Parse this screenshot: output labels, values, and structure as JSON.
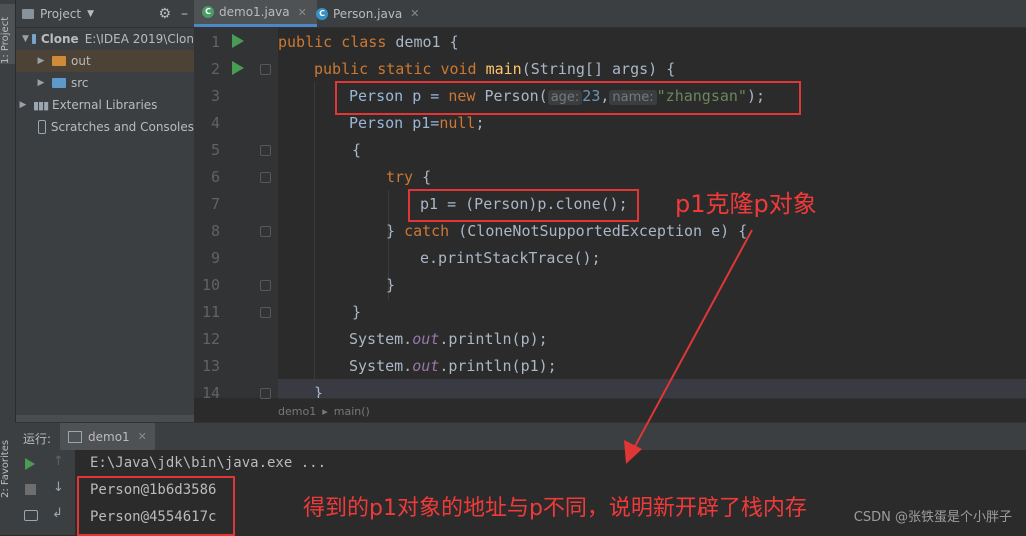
{
  "left_strip": {
    "project_tab": "1: Project",
    "favorites_tab": "2: Favorites"
  },
  "project": {
    "header_label": "Project",
    "tree": [
      {
        "label": "Clone",
        "extra": "E:\\IDEA 2019\\Clon",
        "icon": "module-folder-icon",
        "expanded": true
      },
      {
        "label": "out",
        "icon": "folder-orange-icon",
        "expanded": false
      },
      {
        "label": "src",
        "icon": "folder-blue-icon",
        "expanded": false
      },
      {
        "label": "External Libraries",
        "icon": "library-icon",
        "expanded": false
      },
      {
        "label": "Scratches and Consoles",
        "icon": "scratch-icon",
        "expanded": false
      }
    ]
  },
  "editor": {
    "tabs": [
      {
        "label": "demo1.java",
        "active": true
      },
      {
        "label": "Person.java",
        "active": false
      }
    ],
    "line_numbers": [
      "1",
      "2",
      "3",
      "4",
      "5",
      "6",
      "7",
      "8",
      "9",
      "10",
      "11",
      "12",
      "13",
      "14"
    ],
    "breadcrumb": {
      "first": "demo1",
      "second": "main()"
    },
    "hints": {
      "age": "age:",
      "name": "name:"
    },
    "code": {
      "l1": [
        "public",
        "class",
        "demo1 {"
      ],
      "l2": [
        "public",
        "static",
        "void",
        "main",
        "(String[] args) {"
      ],
      "l3": [
        "Person p = ",
        "new",
        " Person(",
        "23",
        ",",
        "\"zhangsan\"",
        ");"
      ],
      "l4": [
        "Person p1=",
        "null",
        ";"
      ],
      "l5": "{",
      "l6": [
        "try",
        " {"
      ],
      "l7": [
        "p1 = (Person)p.clone();"
      ],
      "l8": [
        "} ",
        "catch",
        " (CloneNotSupportedException e) {"
      ],
      "l9": "e.printStackTrace();",
      "l10": "}",
      "l11": "}",
      "l12": [
        "System.",
        "out",
        ".println(p);"
      ],
      "l13": [
        "System.",
        "out",
        ".println(p1);"
      ],
      "l14": "}"
    }
  },
  "run": {
    "label": "运行:",
    "tab": "demo1",
    "console_lines": [
      "E:\\Java\\jdk\\bin\\java.exe ...",
      "Person@1b6d3586",
      "Person@4554617c"
    ]
  },
  "annotations": {
    "clone_note": "p1克隆p对象",
    "result_note": "得到的p1对象的地址与p不同，说明新开辟了栈内存"
  },
  "watermark": "CSDN @张铁蛋是个小胖子",
  "colors": {
    "annotation_red": "#e03636",
    "keyword": "#cc7832",
    "run_green": "#499c54"
  }
}
